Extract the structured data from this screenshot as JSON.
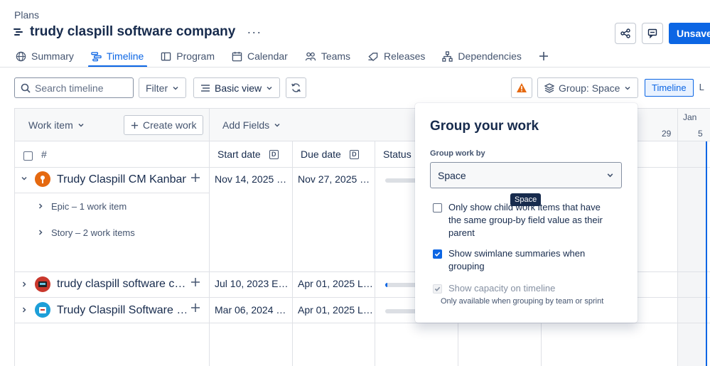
{
  "breadcrumb": "Plans",
  "page_title": "trudy claspill software company",
  "more_label": "···",
  "unsaved_label": "Unsaved",
  "tabs": [
    {
      "label": "Summary",
      "icon": "globe-icon"
    },
    {
      "label": "Timeline",
      "icon": "timeline-icon",
      "active": true
    },
    {
      "label": "Program",
      "icon": "program-icon"
    },
    {
      "label": "Calendar",
      "icon": "calendar-icon"
    },
    {
      "label": "Teams",
      "icon": "teams-icon"
    },
    {
      "label": "Releases",
      "icon": "releases-icon"
    },
    {
      "label": "Dependencies",
      "icon": "dependencies-icon"
    }
  ],
  "toolbar": {
    "search_placeholder": "Search timeline",
    "filter_label": "Filter",
    "view_label": "Basic view",
    "group_label": "Group: Space",
    "timeline_label": "Timeline",
    "next_view_label": "L"
  },
  "grid": {
    "work_item_label": "Work item",
    "create_work_label": "Create work",
    "add_fields_label": "Add Fields",
    "hash_label": "#",
    "start_date_label": "Start date",
    "due_date_label": "Due date",
    "status_label": "Status",
    "d_badge": "D",
    "month_label": "Jan",
    "day_29": "29",
    "day_5": "5",
    "rows": [
      {
        "title": "Trudy Claspill CM Kanban",
        "start": "Nov 14, 2025 …",
        "due": "Nov 27, 2025 …",
        "progress": 0
      },
      {
        "title": "trudy claspill software c…",
        "start": "Jul 10, 2023 E…",
        "due": "Apr 01, 2025 L…",
        "progress": 0.05
      },
      {
        "title": "Trudy Claspill Software …",
        "start": "Mar 06, 2024 …",
        "due": "Apr 01, 2025 L…",
        "progress": 0
      }
    ],
    "sub_rows": [
      "Epic – 1 work item",
      "Story – 2 work items"
    ]
  },
  "popup": {
    "title": "Group your work",
    "group_by_label": "Group work by",
    "group_by_value": "Space",
    "tooltip": "Space",
    "option_child_line1": "Only show child work items that have",
    "option_child_line2": "the same group-by field value as their",
    "option_child_line3": "parent",
    "option_child_checked": false,
    "option_swimlane_line1": "Show swimlane summaries when",
    "option_swimlane_line2": "grouping",
    "option_swimlane_checked": true,
    "option_capacity": "Show capacity on timeline",
    "option_capacity_checked": true,
    "capacity_hint": "Only available when grouping by team or sprint"
  },
  "colors": {
    "accent": "#0c66e4",
    "warning": "#e56910"
  }
}
